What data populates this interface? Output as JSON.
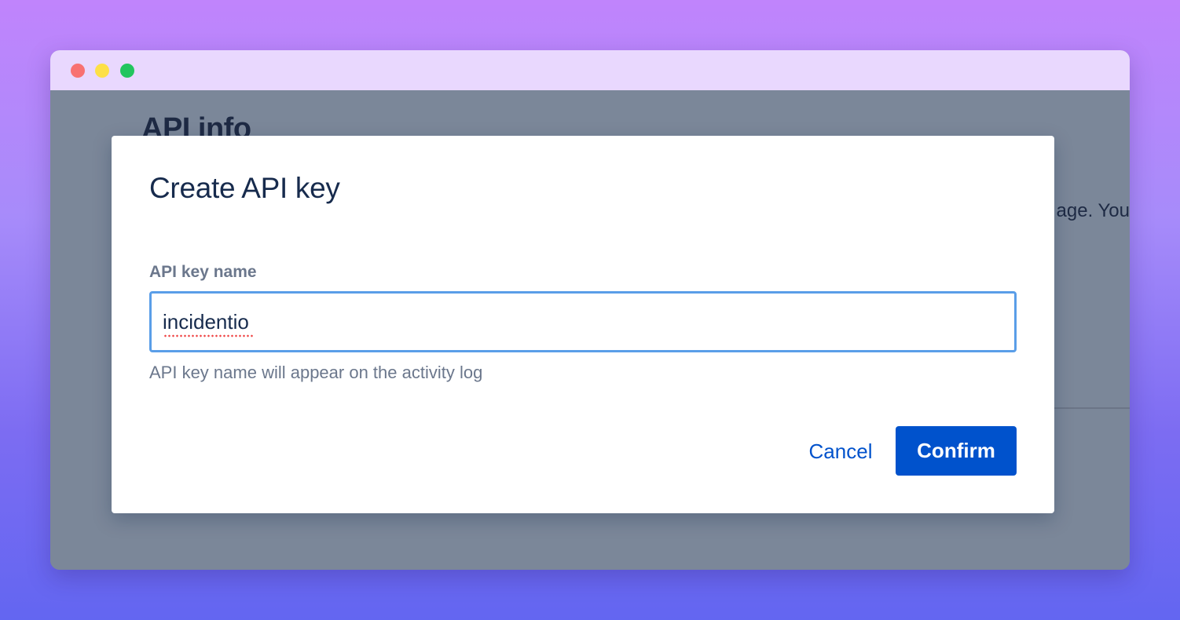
{
  "window": {
    "controls": [
      "close",
      "minimize",
      "maximize"
    ]
  },
  "background_page": {
    "heading": "API info",
    "partial_text": "age. You"
  },
  "modal": {
    "title": "Create API key",
    "field": {
      "label": "API key name",
      "value": "incidentio",
      "helper": "API key name will appear on the activity log"
    },
    "actions": {
      "cancel_label": "Cancel",
      "confirm_label": "Confirm"
    }
  },
  "colors": {
    "accent": "#0052cc",
    "input_focus_border": "#5a9ee8",
    "overlay": "#7b8799",
    "titlebar": "#e9d8fe"
  }
}
